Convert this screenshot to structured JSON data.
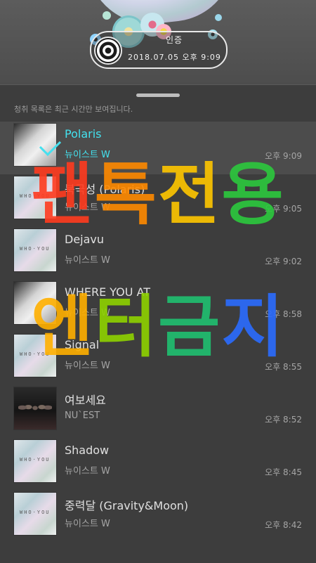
{
  "header": {
    "pill_title": "인증",
    "pill_date": "2018.07.05 오후 9:09"
  },
  "sheet": {
    "notice": "청취 목록은 최근 시간만 보여집니다."
  },
  "songs": [
    {
      "title": "Polaris",
      "artist": "뉴이스트 W",
      "time": "오후 9:09",
      "selected": true
    },
    {
      "title": "북극성 (Polaris)",
      "artist": "뉴이스트 W",
      "time": "오후 9:05",
      "selected": false
    },
    {
      "title": "Dejavu",
      "artist": "뉴이스트 W",
      "time": "오후 9:02",
      "selected": false
    },
    {
      "title": "WHERE YOU AT",
      "artist": "뉴이스트 W",
      "time": "오후 8:58",
      "selected": false
    },
    {
      "title": "Signal",
      "artist": "뉴이스트 W",
      "time": "오후 8:55",
      "selected": false
    },
    {
      "title": "여보세요",
      "artist": "NU`EST",
      "time": "오후 8:52",
      "selected": false
    },
    {
      "title": "Shadow",
      "artist": "뉴이스트 W",
      "time": "오후 8:45",
      "selected": false
    },
    {
      "title": "중력달 (Gravity&Moon)",
      "artist": "뉴이스트 W",
      "time": "오후 8:42",
      "selected": false
    }
  ],
  "watermark": {
    "line1": [
      "팬",
      "톡",
      "전",
      "용"
    ],
    "line2": [
      "엔",
      "터",
      "금",
      "지"
    ],
    "colors1": [
      "#ff3b1f",
      "#ff8a00",
      "#ffc700",
      "#2cc93d"
    ],
    "colors2": [
      "#ffb000",
      "#8ed200",
      "#20c070",
      "#2b6cff"
    ]
  },
  "colors": {
    "accent": "#43e2ef",
    "background": "#3d3d3d"
  }
}
